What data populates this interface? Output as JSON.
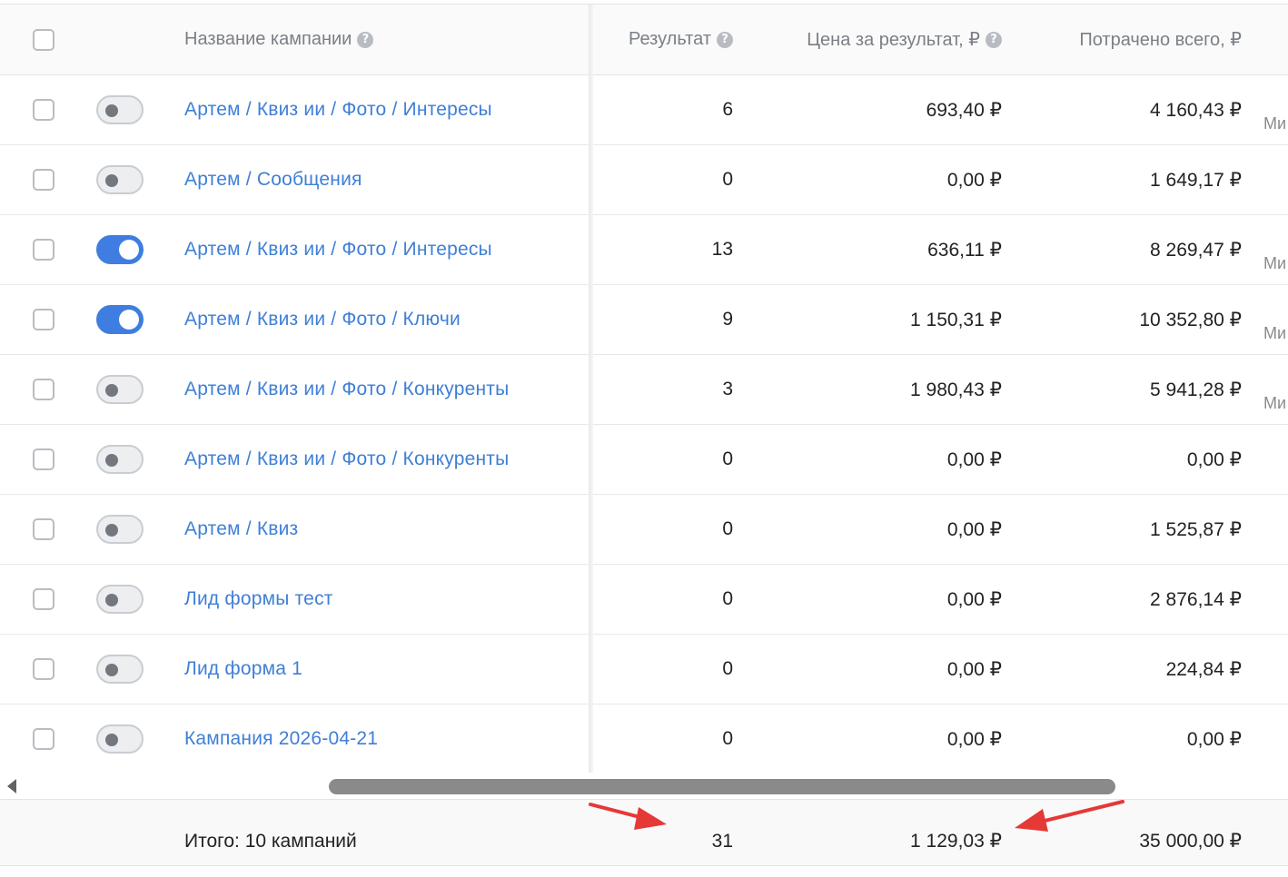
{
  "header": {
    "campaign_name": "Название кампании",
    "result": "Результат",
    "price_per_result": "Цена за результат, ₽",
    "spent_total": "Потрачено всего, ₽",
    "help_glyph": "?"
  },
  "rows": [
    {
      "enabled": false,
      "name": "Артем / Квиз ии / Фото / Интересы",
      "result": "6",
      "price": "693,40 ₽",
      "spent": "4 160,43 ₽",
      "extra": "Ми"
    },
    {
      "enabled": false,
      "name": "Артем / Сообщения",
      "result": "0",
      "price": "0,00 ₽",
      "spent": "1 649,17 ₽",
      "extra": ""
    },
    {
      "enabled": true,
      "name": "Артем / Квиз ии / Фото / Интересы",
      "result": "13",
      "price": "636,11 ₽",
      "spent": "8 269,47 ₽",
      "extra": "Ми"
    },
    {
      "enabled": true,
      "name": "Артем / Квиз ии / Фото / Ключи",
      "result": "9",
      "price": "1 150,31 ₽",
      "spent": "10 352,80 ₽",
      "extra": "Ми"
    },
    {
      "enabled": false,
      "name": "Артем / Квиз ии / Фото / Конкуренты",
      "result": "3",
      "price": "1 980,43 ₽",
      "spent": "5 941,28 ₽",
      "extra": "Ми"
    },
    {
      "enabled": false,
      "name": "Артем / Квиз ии / Фото / Конкуренты",
      "result": "0",
      "price": "0,00 ₽",
      "spent": "0,00 ₽",
      "extra": ""
    },
    {
      "enabled": false,
      "name": "Артем / Квиз",
      "result": "0",
      "price": "0,00 ₽",
      "spent": "1 525,87 ₽",
      "extra": ""
    },
    {
      "enabled": false,
      "name": "Лид формы тест",
      "result": "0",
      "price": "0,00 ₽",
      "spent": "2 876,14 ₽",
      "extra": ""
    },
    {
      "enabled": false,
      "name": "Лид форма 1",
      "result": "0",
      "price": "0,00 ₽",
      "spent": "224,84 ₽",
      "extra": ""
    },
    {
      "enabled": false,
      "name": "Кампания 2026-04-21",
      "result": "0",
      "price": "0,00 ₽",
      "spent": "0,00 ₽",
      "extra": ""
    }
  ],
  "footer": {
    "total_label": "Итого: 10 кампаний",
    "result": "31",
    "price": "1 129,03 ₽",
    "spent": "35 000,00 ₽"
  },
  "colors": {
    "link": "#3f7fd6",
    "toggle_on": "#3f7ee0",
    "annotation_arrow": "#e53935"
  },
  "icons": {
    "help": "question-circle-icon",
    "scroll_left": "scroll-left-arrow-icon",
    "annotation": "red-arrow-annotation-icon"
  }
}
